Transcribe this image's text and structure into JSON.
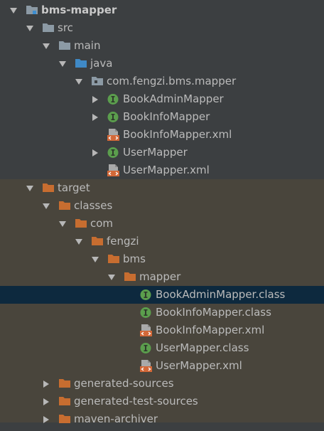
{
  "colors": {
    "panel_bg": "#3c3f41",
    "excluded_bg": "#49453c",
    "selection_bg": "#0d293e",
    "folder_grey": "#8c9aa5",
    "folder_orange": "#c76d30",
    "folder_blue": "#3f89c6",
    "interface_green": "#5b9e4d",
    "xml_badge_red": "#d36838"
  },
  "tree": {
    "rows": [
      {
        "label": "bms-mapper",
        "depth": 0,
        "arrow": "down",
        "icon": "module-folder-icon",
        "bold": true
      },
      {
        "label": "src",
        "depth": 1,
        "arrow": "down",
        "icon": "folder-grey-icon"
      },
      {
        "label": "main",
        "depth": 2,
        "arrow": "down",
        "icon": "folder-grey-icon"
      },
      {
        "label": "java",
        "depth": 3,
        "arrow": "down",
        "icon": "source-root-folder-icon"
      },
      {
        "label": "com.fengzi.bms.mapper",
        "depth": 4,
        "arrow": "down",
        "icon": "package-icon"
      },
      {
        "label": "BookAdminMapper",
        "depth": 5,
        "arrow": "right",
        "icon": "interface-icon"
      },
      {
        "label": "BookInfoMapper",
        "depth": 5,
        "arrow": "right",
        "icon": "interface-icon"
      },
      {
        "label": "BookInfoMapper.xml",
        "depth": 5,
        "arrow": "none",
        "icon": "xml-file-icon"
      },
      {
        "label": "UserMapper",
        "depth": 5,
        "arrow": "right",
        "icon": "interface-icon"
      },
      {
        "label": "UserMapper.xml",
        "depth": 5,
        "arrow": "none",
        "icon": "xml-file-icon"
      },
      {
        "label": "target",
        "depth": 1,
        "arrow": "down",
        "icon": "folder-orange-icon",
        "excluded": true
      },
      {
        "label": "classes",
        "depth": 2,
        "arrow": "down",
        "icon": "folder-orange-icon",
        "excluded": true
      },
      {
        "label": "com",
        "depth": 3,
        "arrow": "down",
        "icon": "folder-orange-icon",
        "excluded": true
      },
      {
        "label": "fengzi",
        "depth": 4,
        "arrow": "down",
        "icon": "folder-orange-icon",
        "excluded": true
      },
      {
        "label": "bms",
        "depth": 5,
        "arrow": "down",
        "icon": "folder-orange-icon",
        "excluded": true
      },
      {
        "label": "mapper",
        "depth": 6,
        "arrow": "down",
        "icon": "folder-orange-icon",
        "excluded": true
      },
      {
        "label": "BookAdminMapper.class",
        "depth": 7,
        "arrow": "none",
        "icon": "interface-icon",
        "excluded": true,
        "selected": true
      },
      {
        "label": "BookInfoMapper.class",
        "depth": 7,
        "arrow": "none",
        "icon": "interface-icon",
        "excluded": true
      },
      {
        "label": "BookInfoMapper.xml",
        "depth": 7,
        "arrow": "none",
        "icon": "xml-file-icon",
        "excluded": true
      },
      {
        "label": "UserMapper.class",
        "depth": 7,
        "arrow": "none",
        "icon": "interface-icon",
        "excluded": true
      },
      {
        "label": "UserMapper.xml",
        "depth": 7,
        "arrow": "none",
        "icon": "xml-file-icon",
        "excluded": true
      },
      {
        "label": "generated-sources",
        "depth": 2,
        "arrow": "right",
        "icon": "folder-orange-icon",
        "excluded": true
      },
      {
        "label": "generated-test-sources",
        "depth": 2,
        "arrow": "right",
        "icon": "folder-orange-icon",
        "excluded": true
      },
      {
        "label": "maven-archiver",
        "depth": 2,
        "arrow": "right",
        "icon": "folder-orange-icon",
        "excluded": true
      }
    ]
  }
}
